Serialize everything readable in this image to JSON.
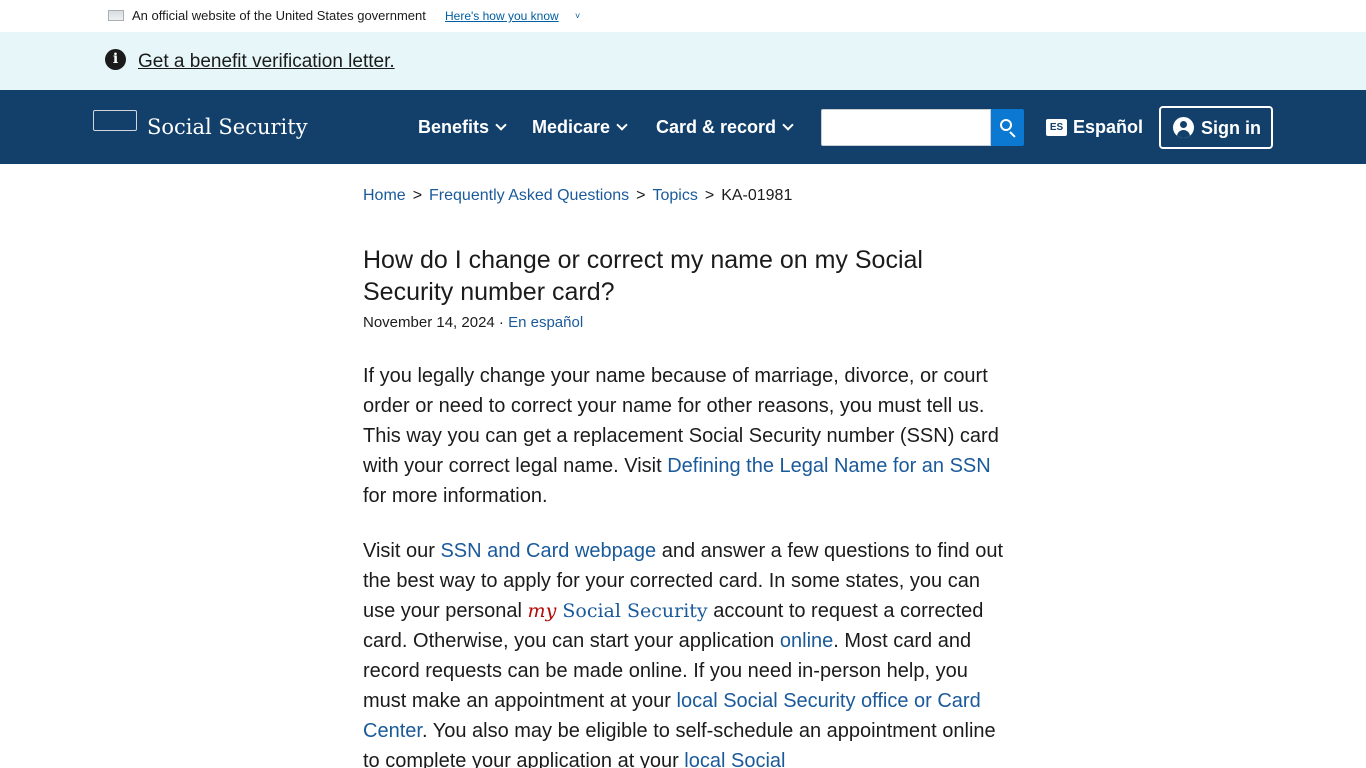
{
  "gov_banner": {
    "text": "An official website of the United States government",
    "link": "Here's how you know",
    "chevron": "˅"
  },
  "alert": {
    "icon": "info-icon",
    "icon_glyph": "i",
    "link": "Get a benefit verification letter."
  },
  "header": {
    "logo_text": "Social Security",
    "nav": [
      "Benefits",
      "Medicare",
      "Card & record"
    ],
    "search_value": "",
    "language_badge": "ES",
    "language_link": "Español",
    "signin_label": "Sign in",
    "colors": {
      "header_bg": "#12406b",
      "search_button": "#0b78d1"
    }
  },
  "breadcrumb": {
    "items": [
      "Home",
      "Frequently Asked Questions",
      "Topics"
    ],
    "current": "KA-01981",
    "separator": ">"
  },
  "article": {
    "title": "How do I change or correct my name on my Social Security number card?",
    "date": "November 14, 2024",
    "dot": "·",
    "lang_link": "En español",
    "p1": {
      "text_before": "If you legally change your name because of marriage, divorce, or court order or need to correct your name for other reasons, you must tell us. This way you can get a replacement Social Security number (SSN) card with your correct legal name. Visit ",
      "link": "Defining the Legal Name for an SSN",
      "text_after": " for more information."
    },
    "p2": {
      "t1": "Visit our ",
      "l1": "SSN and Card webpage",
      "t2": " and answer a few questions to find out the best way to apply for your corrected card. In some states, you can use your personal ",
      "my": "my",
      "ss": "Social Security",
      "t3": " account to request a corrected card. Otherwise, you can start your application ",
      "l2": "online",
      "t4": ". Most card and record requests can be made online. If you need in-person help, you must make an appointment at your ",
      "l3": "local Social Security office or Card Center",
      "t5": ". You also may be eligible to self-schedule an appointment online to complete your application at your ",
      "l4": "local Social"
    }
  }
}
